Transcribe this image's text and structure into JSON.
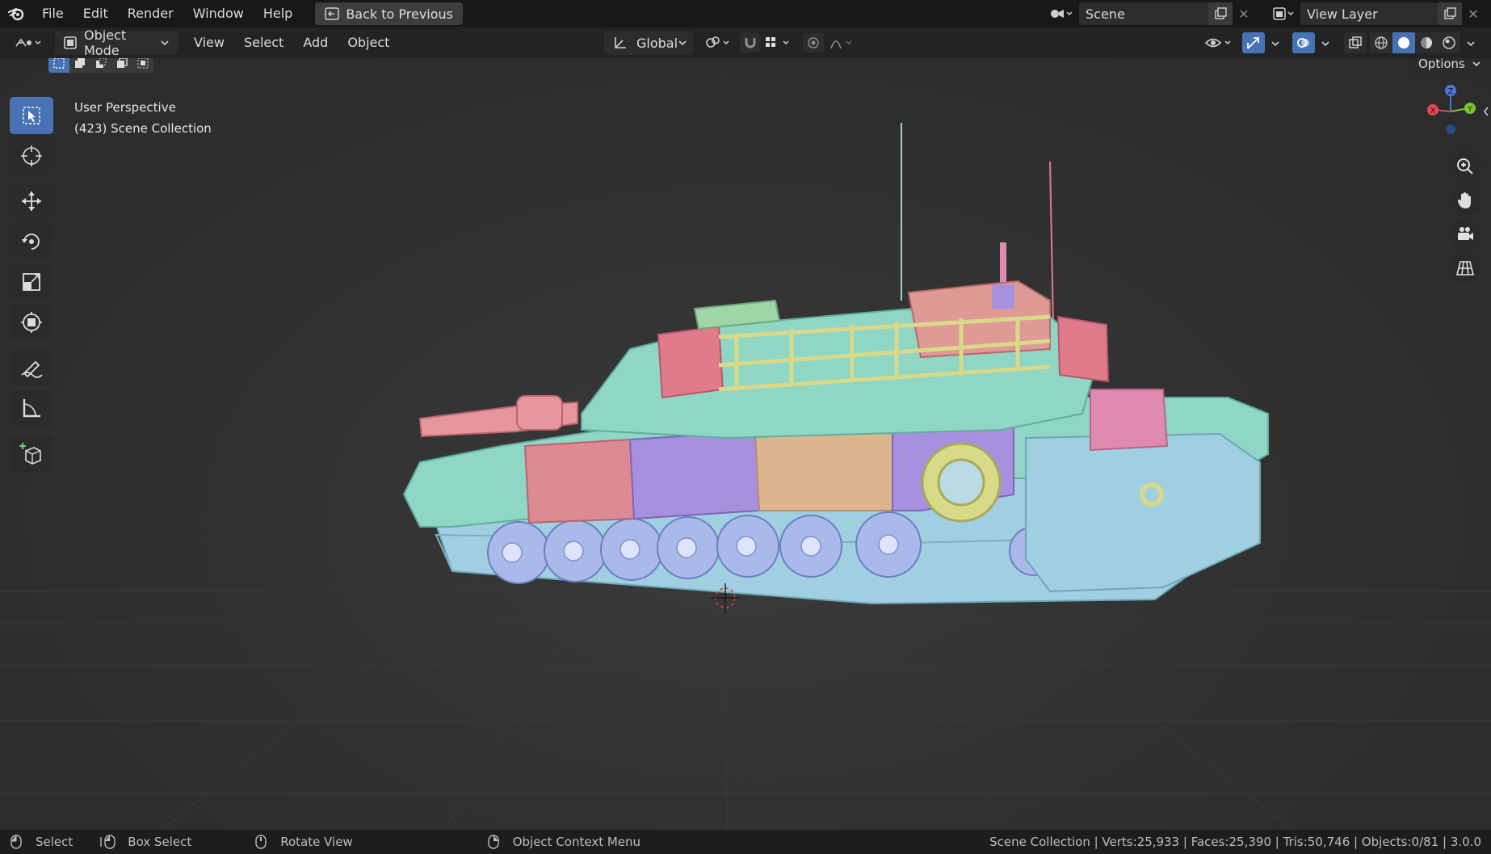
{
  "topbar": {
    "menu": [
      "File",
      "Edit",
      "Render",
      "Window",
      "Help"
    ],
    "back_label": "Back to Previous",
    "scene_label": "Scene",
    "view_layer_label": "View Layer"
  },
  "header": {
    "mode": "Object Mode",
    "menus": [
      "View",
      "Select",
      "Add",
      "Object"
    ],
    "orientation": "Global",
    "options_label": "Options"
  },
  "viewport": {
    "view_name": "User Perspective",
    "collection": "(423) Scene Collection"
  },
  "statusbar": {
    "select": "Select",
    "box_select": "Box Select",
    "rotate_view": "Rotate View",
    "context_menu": "Object Context Menu",
    "stats": "Scene Collection | Verts:25,933 | Faces:25,390 | Tris:50,746 | Objects:0/81 | 3.0.0"
  },
  "colors": {
    "accent": "#4772b3",
    "tank_teal": "#8fd6c4",
    "tank_blue": "#9ad0e0",
    "tank_pink": "#dd8a94",
    "tank_purple": "#a98fe0",
    "tank_tan": "#dcb58e",
    "tank_yellow": "#d9d98a"
  }
}
